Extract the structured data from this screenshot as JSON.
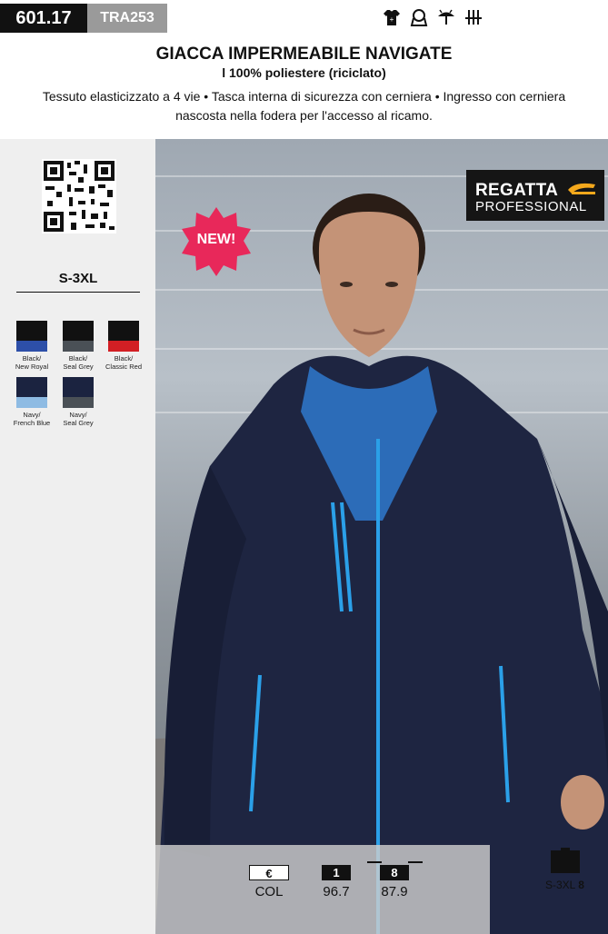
{
  "header": {
    "code_main": "601.17",
    "code_sub": "TRA253",
    "care_icons": [
      "tshirt-icon",
      "hood-icon",
      "umbrella-rain-icon",
      "breathable-icon"
    ],
    "title": "GIACCA IMPERMEABILE NAVIGATE",
    "subtitle": "l 100% poliestere (riciclato)",
    "description": "Tessuto elasticizzato a 4 vie • Tasca interna di sicurezza con cerniera • Ingresso con cerniera nascosta nella fodera per l'accesso al ricamo."
  },
  "sidebar": {
    "size_range": "S-3XL",
    "colors": [
      {
        "label": "Black/\nNew Royal",
        "top": "#111111",
        "bottom": "#2d4fa8"
      },
      {
        "label": "Black/\nSeal Grey",
        "top": "#111111",
        "bottom": "#4a5056"
      },
      {
        "label": "Black/\nClassic Red",
        "top": "#111111",
        "bottom": "#d21f24"
      },
      {
        "label": "Navy/\nFrench Blue",
        "top": "#1b2340",
        "bottom": "#8ebbe3"
      },
      {
        "label": "Navy/\nSeal Grey",
        "top": "#1b2340",
        "bottom": "#4a5056"
      }
    ]
  },
  "photo": {
    "brand_top": "REGATTA",
    "brand_bottom": "PROFESSIONAL",
    "badge": "NEW!",
    "badge_color": "#e8285a"
  },
  "pricing": {
    "currency_label": "€",
    "currency_value": "COL",
    "tier1_label": "1",
    "tier1_value": "96.7",
    "tier2_label": "8",
    "tier2_value": "87.9",
    "box_sizes": "S-3XL",
    "box_qty": "8"
  }
}
